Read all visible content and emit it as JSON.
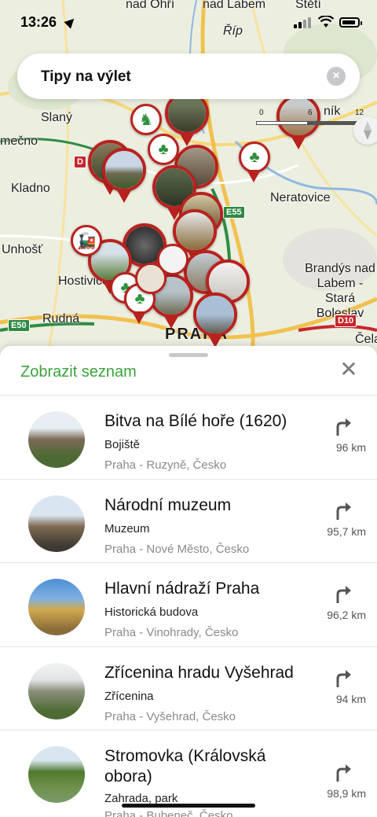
{
  "status": {
    "time": "13:26"
  },
  "search": {
    "title": "Tipy na výlet"
  },
  "map": {
    "labels": [
      "nad Ohří",
      "nad Labem",
      "Štětí",
      "Říp",
      "Slaný",
      "mečno",
      "Kladno",
      "Neratovice",
      "Unhošť",
      "Hostivice",
      "Rudná",
      "Brandýs nad Labem - Stará Boleslav",
      "Čela",
      "PRAHA",
      "ník"
    ],
    "roads": [
      "E55",
      "E50",
      "D10",
      "D"
    ],
    "scale": {
      "a": "0",
      "b": "6",
      "c": "12"
    }
  },
  "sheet": {
    "show_list": "Zobrazit seznam",
    "close_icon": "close-icon",
    "items": [
      {
        "title": "Bitva na Bílé hoře (1620)",
        "type": "Bojiště",
        "address": "Praha - Ruzyně, Česko",
        "distance": "96 km"
      },
      {
        "title": "Národní muzeum",
        "type": "Muzeum",
        "address": "Praha - Nové Město, Česko",
        "distance": "95,7 km"
      },
      {
        "title": "Hlavní nádraží Praha",
        "type": "Historická budova",
        "address": "Praha - Vinohrady, Česko",
        "distance": "96,2 km"
      },
      {
        "title": "Zřícenina hradu Vyšehrad",
        "type": "Zřícenina",
        "address": "Praha - Vyšehrad, Česko",
        "distance": "94 km"
      },
      {
        "title": "Stromovka (Královská obora)",
        "type": "Zahrada, park",
        "address": "Praha - Bubeneč, Česko",
        "distance": "98,9 km"
      }
    ]
  },
  "colors": {
    "accent": "#3aa33c",
    "pin": "#b8221e",
    "road_green": "#2e8b43"
  }
}
